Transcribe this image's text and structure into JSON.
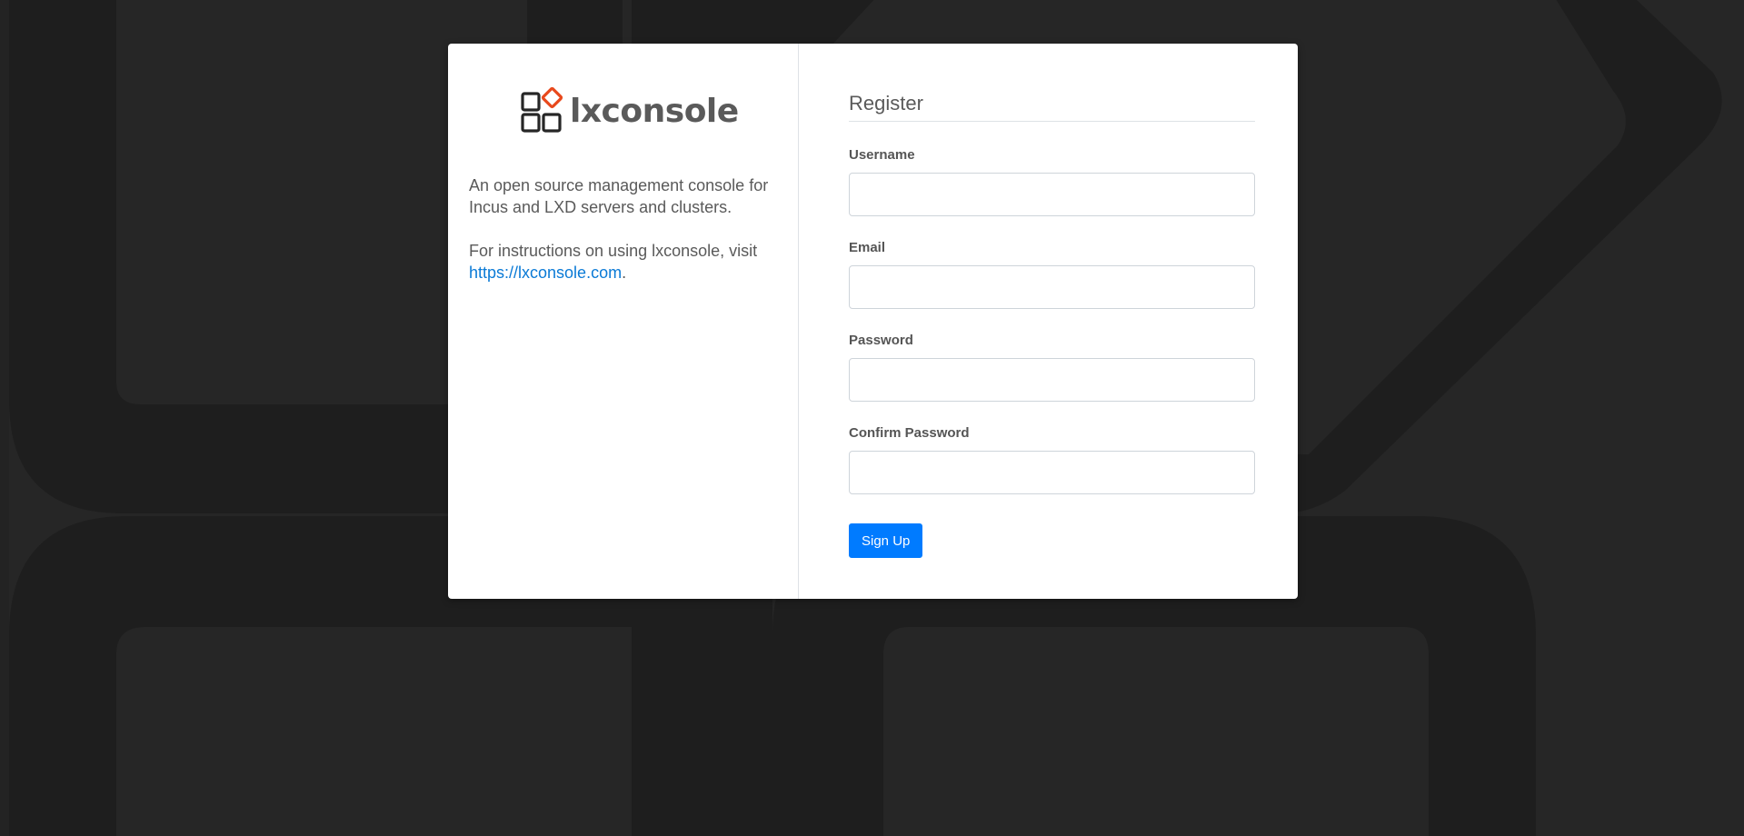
{
  "colors": {
    "background": "#262626",
    "accent": "#007bff",
    "link": "#0a7ad6",
    "logo_orange": "#e8491d"
  },
  "brand": {
    "name": "lxconsole",
    "logo_icon": "lxconsole-logo-icon"
  },
  "about": {
    "description": "An open source management console for Incus and LXD servers and clusters.",
    "instructions_prefix": "For instructions on using lxconsole, visit ",
    "link_text": "https://lxconsole.com",
    "instructions_suffix": "."
  },
  "form": {
    "title": "Register",
    "fields": [
      {
        "label": "Username",
        "value": "",
        "placeholder": ""
      },
      {
        "label": "Email",
        "value": "",
        "placeholder": ""
      },
      {
        "label": "Password",
        "value": "",
        "placeholder": ""
      },
      {
        "label": "Confirm Password",
        "value": "",
        "placeholder": ""
      }
    ],
    "submit_label": "Sign Up"
  }
}
